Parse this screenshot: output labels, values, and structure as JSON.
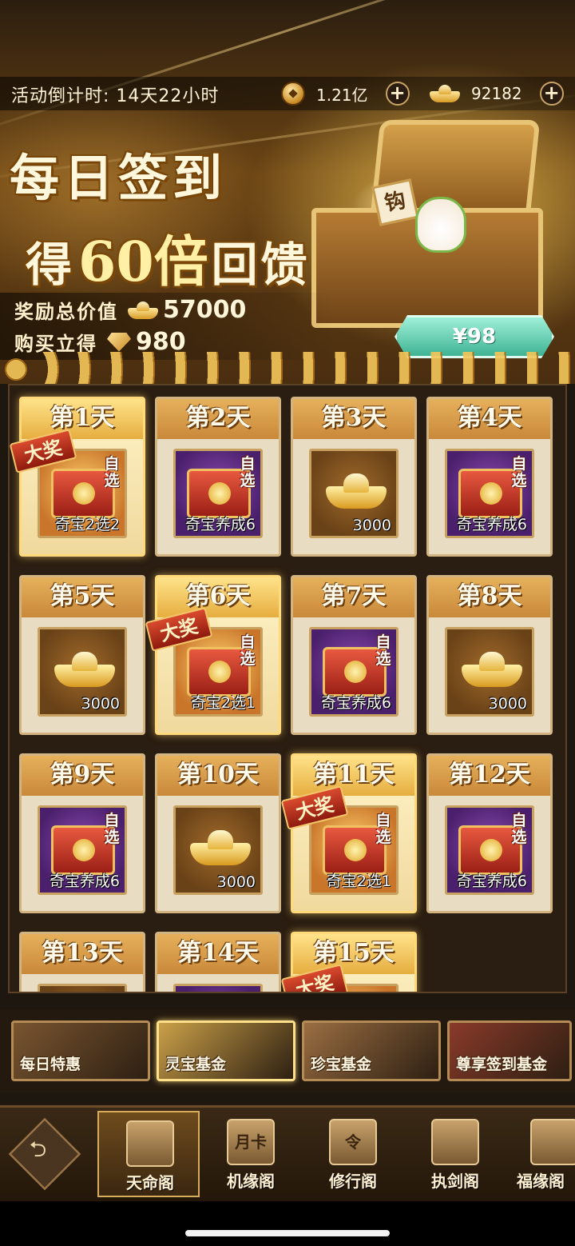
{
  "header": {
    "countdown": "活动倒计时: 14天22小时",
    "copper": "1.21亿",
    "gold": "92182",
    "plus": "+"
  },
  "promo": {
    "title_line1": "每日签到",
    "title_line2_a": "得",
    "title_line2_b": "60倍",
    "title_line2_c": "回馈",
    "chest_tag": "钩",
    "reward_label": "奖励总价值",
    "reward_value": "57000",
    "buy_label": "购买立得",
    "buy_value": "980",
    "price": "¥98"
  },
  "days": [
    {
      "label": "第1天",
      "type": "box",
      "bg": "gold",
      "big": true,
      "ribbon": "大奖",
      "badge": "自选",
      "caption": "奇宝2选2"
    },
    {
      "label": "第2天",
      "type": "box",
      "bg": "purple",
      "big": false,
      "ribbon": "",
      "badge": "自选",
      "caption": "奇宝养成6"
    },
    {
      "label": "第3天",
      "type": "ingot",
      "bg": "ingot",
      "big": false,
      "ribbon": "",
      "badge": "",
      "caption": "3000"
    },
    {
      "label": "第4天",
      "type": "box",
      "bg": "purple",
      "big": false,
      "ribbon": "",
      "badge": "自选",
      "caption": "奇宝养成6"
    },
    {
      "label": "第5天",
      "type": "ingot",
      "bg": "ingot",
      "big": false,
      "ribbon": "",
      "badge": "",
      "caption": "3000"
    },
    {
      "label": "第6天",
      "type": "box",
      "bg": "gold",
      "big": true,
      "ribbon": "大奖",
      "badge": "自选",
      "caption": "奇宝2选1"
    },
    {
      "label": "第7天",
      "type": "box",
      "bg": "purple",
      "big": false,
      "ribbon": "",
      "badge": "自选",
      "caption": "奇宝养成6"
    },
    {
      "label": "第8天",
      "type": "ingot",
      "bg": "ingot",
      "big": false,
      "ribbon": "",
      "badge": "",
      "caption": "3000"
    },
    {
      "label": "第9天",
      "type": "box",
      "bg": "purple",
      "big": false,
      "ribbon": "",
      "badge": "自选",
      "caption": "奇宝养成6"
    },
    {
      "label": "第10天",
      "type": "ingot",
      "bg": "ingot",
      "big": false,
      "ribbon": "",
      "badge": "",
      "caption": "3000"
    },
    {
      "label": "第11天",
      "type": "box",
      "bg": "gold",
      "big": true,
      "ribbon": "大奖",
      "badge": "自选",
      "caption": "奇宝2选1"
    },
    {
      "label": "第12天",
      "type": "box",
      "bg": "purple",
      "big": false,
      "ribbon": "",
      "badge": "自选",
      "caption": "奇宝养成6"
    },
    {
      "label": "第13天",
      "type": "ingot",
      "bg": "ingot",
      "big": false,
      "ribbon": "",
      "badge": "",
      "caption": ""
    },
    {
      "label": "第14天",
      "type": "box",
      "bg": "purple",
      "big": false,
      "ribbon": "",
      "badge": "",
      "caption": ""
    },
    {
      "label": "第15天",
      "type": "box",
      "bg": "gold",
      "big": true,
      "ribbon": "大奖",
      "badge": "",
      "caption": ""
    }
  ],
  "category_tabs": [
    {
      "label": "每日特惠",
      "active": false,
      "color": "#7a5530"
    },
    {
      "label": "灵宝基金",
      "active": true,
      "color": "#caa048"
    },
    {
      "label": "珍宝基金",
      "active": false,
      "color": "#9a6e42"
    },
    {
      "label": "尊享签到基金",
      "active": false,
      "color": "#8a3a2a"
    }
  ],
  "nav": {
    "back": "⮌",
    "items": [
      {
        "label": "天命阁",
        "active": true,
        "icon": "treasure-chest-icon"
      },
      {
        "label": "机缘阁",
        "active": false,
        "icon": "month-card-icon",
        "icon_text": "月卡"
      },
      {
        "label": "修行阁",
        "active": false,
        "icon": "token-icon",
        "icon_text": "令"
      },
      {
        "label": "执剑阁",
        "active": false,
        "icon": "swords-icon"
      },
      {
        "label": "福缘阁",
        "active": false,
        "icon": "shop-icon"
      }
    ]
  }
}
